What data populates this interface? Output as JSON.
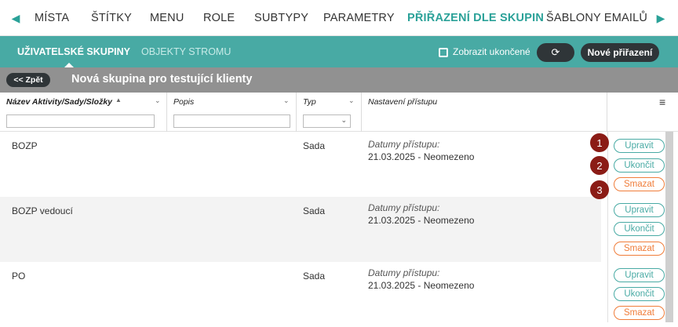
{
  "top_nav": {
    "tabs": [
      "MÍSTA",
      "ŠTÍTKY",
      "MENU",
      "ROLE",
      "SUBTYPY",
      "PARAMETRY",
      "PŘIŘAZENÍ DLE SKUPIN",
      "ŠABLONY EMAILŮ"
    ],
    "active_tab": "PŘIŘAZENÍ DLE SKUPIN"
  },
  "sub_nav": {
    "tabs": [
      "UŽIVATELSKÉ SKUPINY",
      "OBJEKTY STROMU"
    ],
    "show_ended_label": "Zobrazit ukončené",
    "refresh_icon": "refresh-icon",
    "new_button": "Nové přiřazení"
  },
  "group_bar": {
    "back_label": "<< Zpět",
    "title": "Nová skupina pro testující klienty"
  },
  "table": {
    "columns": [
      "Název Aktivity/Sady/Složky",
      "Popis",
      "Typ",
      "Nastavení přístupu"
    ],
    "sort_indicator": "▲",
    "rows": [
      {
        "name": "BOZP",
        "popis": "",
        "typ": "Sada",
        "access_label": "Datumy přístupu:",
        "access_value": "21.03.2025 - Neomezeno"
      },
      {
        "name": "BOZP vedoucí",
        "popis": "",
        "typ": "Sada",
        "access_label": "Datumy přístupu:",
        "access_value": "21.03.2025 - Neomezeno"
      },
      {
        "name": "PO",
        "popis": "",
        "typ": "Sada",
        "access_label": "Datumy přístupu:",
        "access_value": "21.03.2025 - Neomezeno"
      }
    ],
    "actions": {
      "edit": "Upravit",
      "end": "Ukončit",
      "delete": "Smazat"
    }
  },
  "badges": [
    "1",
    "2",
    "3"
  ],
  "colors": {
    "accent": "#48aaa4",
    "dark_button": "#2f3538",
    "delete": "#f07d3a",
    "badge": "#8b1c16"
  }
}
